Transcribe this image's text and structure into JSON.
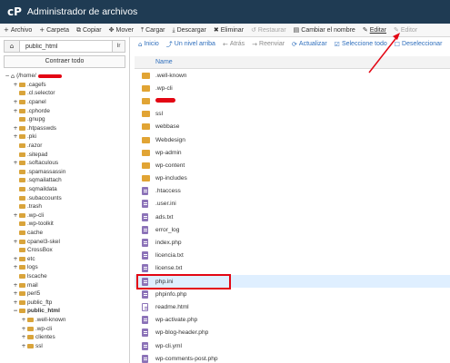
{
  "app": {
    "logo": "cP",
    "title": "Administrador de archivos"
  },
  "toolbar": [
    {
      "icon": "+",
      "label": "Archivo",
      "name": "new-file-button",
      "disabled": false
    },
    {
      "icon": "+",
      "label": "Carpeta",
      "name": "new-folder-button",
      "disabled": false
    },
    {
      "icon": "⧉",
      "label": "Copiar",
      "name": "copy-button",
      "disabled": false
    },
    {
      "icon": "✥",
      "label": "Mover",
      "name": "move-button",
      "disabled": false
    },
    {
      "icon": "⤒",
      "label": "Cargar",
      "name": "upload-button",
      "disabled": false
    },
    {
      "icon": "⤓",
      "label": "Descargar",
      "name": "download-button",
      "disabled": false
    },
    {
      "icon": "✖",
      "label": "Eliminar",
      "name": "delete-button",
      "disabled": false
    },
    {
      "icon": "↺",
      "label": "Restaurar",
      "name": "restore-button",
      "disabled": true
    },
    {
      "icon": "▤",
      "label": "Cambiar el nombre",
      "name": "rename-button",
      "disabled": false
    },
    {
      "icon": "✎",
      "label": "Editar",
      "name": "edit-button",
      "disabled": false
    },
    {
      "icon": "✎",
      "label": "Editor",
      "name": "html-editor-button",
      "disabled": true
    }
  ],
  "sidebar": {
    "home_icon": "⌂",
    "path_value": "public_html",
    "go_label": "Ir",
    "collapse_label": "Contraer todo",
    "tree": [
      {
        "label": "(/home/",
        "level": 0,
        "expander": "−",
        "home": true,
        "redacted": true,
        "bold": false
      },
      {
        "label": ".cagefs",
        "level": 1,
        "expander": "+",
        "bold": false
      },
      {
        "label": ".cl.selector",
        "level": 1,
        "expander": "",
        "bold": false
      },
      {
        "label": ".cpanel",
        "level": 1,
        "expander": "+",
        "bold": false
      },
      {
        "label": ".cphorde",
        "level": 1,
        "expander": "+",
        "bold": false
      },
      {
        "label": ".gnupg",
        "level": 1,
        "expander": "",
        "bold": false
      },
      {
        "label": ".htpasswds",
        "level": 1,
        "expander": "+",
        "bold": false
      },
      {
        "label": ".pki",
        "level": 1,
        "expander": "+",
        "bold": false
      },
      {
        "label": ".razor",
        "level": 1,
        "expander": "",
        "bold": false
      },
      {
        "label": ".sitepad",
        "level": 1,
        "expander": "",
        "bold": false
      },
      {
        "label": ".softaculous",
        "level": 1,
        "expander": "+",
        "bold": false
      },
      {
        "label": ".spamassassin",
        "level": 1,
        "expander": "",
        "bold": false
      },
      {
        "label": ".sqmailattach",
        "level": 1,
        "expander": "",
        "bold": false
      },
      {
        "label": ".sqmaildata",
        "level": 1,
        "expander": "",
        "bold": false
      },
      {
        "label": ".subaccounts",
        "level": 1,
        "expander": "",
        "bold": false
      },
      {
        "label": ".trash",
        "level": 1,
        "expander": "",
        "bold": false
      },
      {
        "label": ".wp-cli",
        "level": 1,
        "expander": "+",
        "bold": false
      },
      {
        "label": ".wp-toolkit",
        "level": 1,
        "expander": "",
        "bold": false
      },
      {
        "label": "cache",
        "level": 1,
        "expander": "",
        "bold": false
      },
      {
        "label": "cpanel3-skel",
        "level": 1,
        "expander": "+",
        "bold": false
      },
      {
        "label": "CrossBox",
        "level": 1,
        "expander": "",
        "bold": false
      },
      {
        "label": "etc",
        "level": 1,
        "expander": "+",
        "bold": false
      },
      {
        "label": "logs",
        "level": 1,
        "expander": "+",
        "bold": false
      },
      {
        "label": "lscache",
        "level": 1,
        "expander": "",
        "bold": false
      },
      {
        "label": "mail",
        "level": 1,
        "expander": "+",
        "bold": false
      },
      {
        "label": "perl5",
        "level": 1,
        "expander": "+",
        "bold": false
      },
      {
        "label": "public_ftp",
        "level": 1,
        "expander": "+",
        "bold": false
      },
      {
        "label": "public_html",
        "level": 1,
        "expander": "−",
        "bold": true
      },
      {
        "label": ".well-known",
        "level": 2,
        "expander": "+",
        "bold": false
      },
      {
        "label": ".wp-cli",
        "level": 2,
        "expander": "+",
        "bold": false
      },
      {
        "label": "clientes",
        "level": 2,
        "expander": "+",
        "bold": false
      },
      {
        "label": "ssl",
        "level": 2,
        "expander": "+",
        "bold": false
      }
    ]
  },
  "nav": [
    {
      "icon": "⌂",
      "label": "Inicio",
      "name": "home-nav-button",
      "disabled": false
    },
    {
      "icon": "⤴",
      "label": "Un nivel arriba",
      "name": "up-one-level-button",
      "disabled": false
    },
    {
      "icon": "←",
      "label": "Atrás",
      "name": "back-button",
      "disabled": true
    },
    {
      "icon": "→",
      "label": "Reenviar",
      "name": "forward-button",
      "disabled": true
    },
    {
      "icon": "⟳",
      "label": "Actualizar",
      "name": "refresh-button",
      "disabled": false
    },
    {
      "icon": "☑",
      "label": "Seleccione todo",
      "name": "select-all-button",
      "disabled": false
    },
    {
      "icon": "☐",
      "label": "Deseleccionar",
      "name": "deselect-all-button",
      "disabled": false
    }
  ],
  "table": {
    "column_name": "Name",
    "rows": [
      {
        "name": ".well-known",
        "type": "folder",
        "selected": false,
        "redacted": false
      },
      {
        "name": ".wp-cli",
        "type": "folder",
        "selected": false,
        "redacted": false
      },
      {
        "name": "",
        "type": "folder",
        "selected": false,
        "redacted": true
      },
      {
        "name": "ssl",
        "type": "folder",
        "selected": false,
        "redacted": false
      },
      {
        "name": "webbase",
        "type": "folder",
        "selected": false,
        "redacted": false
      },
      {
        "name": "Webdesign",
        "type": "folder",
        "selected": false,
        "redacted": false
      },
      {
        "name": "wp-admin",
        "type": "folder",
        "selected": false,
        "redacted": false
      },
      {
        "name": "wp-content",
        "type": "folder",
        "selected": false,
        "redacted": false
      },
      {
        "name": "wp-includes",
        "type": "folder",
        "selected": false,
        "redacted": false
      },
      {
        "name": ".htaccess",
        "type": "file",
        "selected": false,
        "redacted": false
      },
      {
        "name": ".user.ini",
        "type": "file",
        "selected": false,
        "redacted": false
      },
      {
        "name": "ads.txt",
        "type": "file",
        "selected": false,
        "redacted": false
      },
      {
        "name": "error_log",
        "type": "file",
        "selected": false,
        "redacted": false
      },
      {
        "name": "index.php",
        "type": "file",
        "selected": false,
        "redacted": false
      },
      {
        "name": "licencia.txt",
        "type": "file",
        "selected": false,
        "redacted": false
      },
      {
        "name": "license.txt",
        "type": "file",
        "selected": false,
        "redacted": false
      },
      {
        "name": "php.ini",
        "type": "file",
        "selected": true,
        "redacted": false
      },
      {
        "name": "phpinfo.php",
        "type": "file",
        "selected": false,
        "redacted": false
      },
      {
        "name": "readme.html",
        "type": "html",
        "selected": false,
        "redacted": false
      },
      {
        "name": "wp-activate.php",
        "type": "file",
        "selected": false,
        "redacted": false
      },
      {
        "name": "wp-blog-header.php",
        "type": "file",
        "selected": false,
        "redacted": false
      },
      {
        "name": "wp-cli.yml",
        "type": "file",
        "selected": false,
        "redacted": false
      },
      {
        "name": "wp-comments-post.php",
        "type": "file",
        "selected": false,
        "redacted": false
      }
    ]
  },
  "colors": {
    "titlebar": "#1f3b53",
    "link": "#2f6fbd",
    "folder": "#e1a434",
    "file": "#8c73b8",
    "annotation": "#e30613",
    "selected_row": "#dfefff"
  }
}
